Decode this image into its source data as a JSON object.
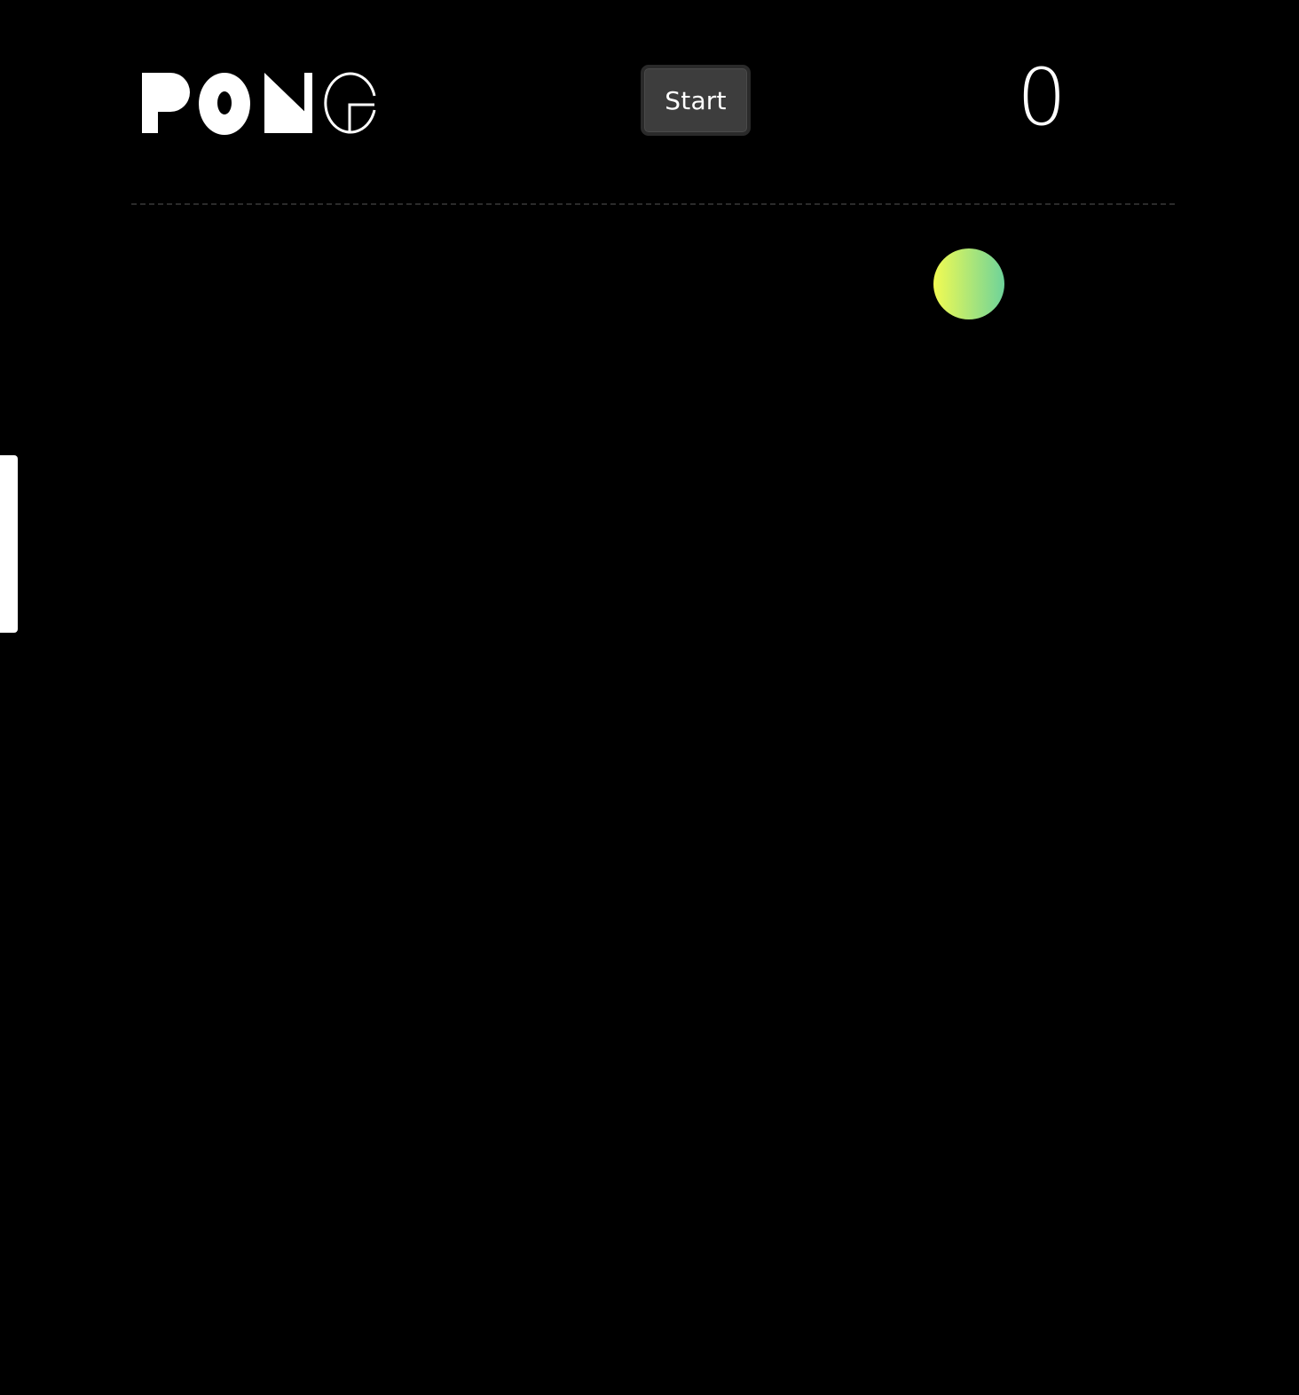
{
  "header": {
    "logo_text": "PONG",
    "start_label": "Start",
    "score": "0"
  },
  "colors": {
    "background": "#000000",
    "paddle": "#ffffff",
    "ball_gradient_start": "#f2fb52",
    "ball_gradient_end": "#6ed39a",
    "button_bg": "#3d3d3d",
    "divider": "#2b2b2b"
  }
}
